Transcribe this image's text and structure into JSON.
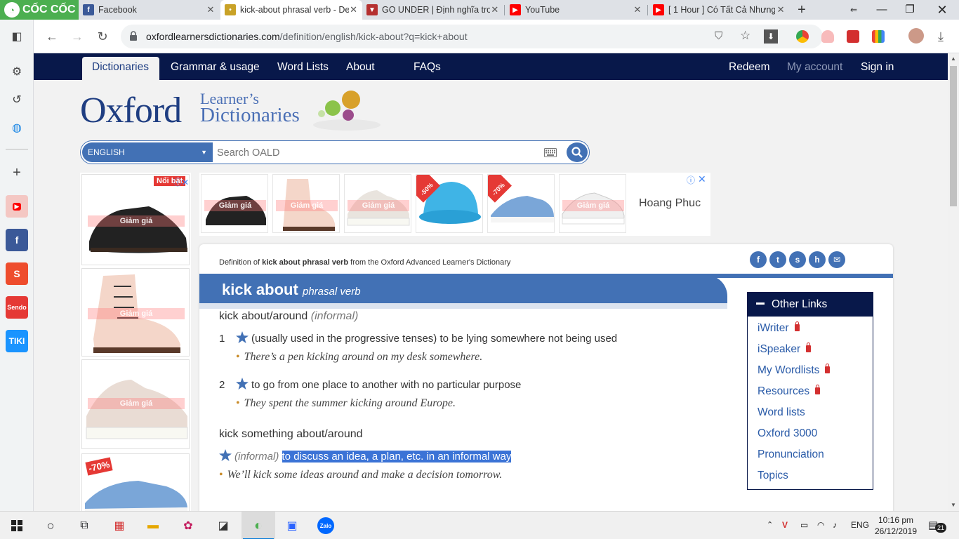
{
  "browser": {
    "brand": "CỐC CỐC",
    "tabs": [
      {
        "title": "Facebook",
        "icon": "facebook-icon",
        "color": "#3b5998"
      },
      {
        "title": "kick-about phrasal verb - Definition",
        "icon": "oxford-icon",
        "color": "#c9a227"
      },
      {
        "title": "GO UNDER | Định nghĩa trong",
        "icon": "cambridge-icon",
        "color": "#b53030"
      },
      {
        "title": "YouTube",
        "icon": "youtube-icon",
        "color": "#ff0000"
      },
      {
        "title": "[ 1 Hour ] Có Tất Cả Nhưng",
        "icon": "youtube-icon",
        "color": "#ff0000"
      }
    ],
    "url_host": "oxfordlearnersdictionaries.com",
    "url_path": "/definition/english/kick-about?q=kick+about"
  },
  "site": {
    "nav_left": [
      "Dictionaries",
      "Grammar & usage",
      "Word Lists",
      "About",
      "FAQs"
    ],
    "nav_right": [
      "Redeem",
      "My account",
      "Sign in"
    ],
    "logo_word": "Oxford",
    "logo_line1": "Learner’s",
    "logo_line2": "Dictionaries",
    "search_lang": "ENGLISH",
    "search_placeholder": "Search OALD"
  },
  "ads": {
    "left_label": "Giảm giá",
    "left_badge_top": "Nổi bật",
    "left_badge_bottom": "-70%",
    "top_label": "Giảm giá",
    "top_badges": [
      "-50%",
      "-70%"
    ],
    "top_brand": "Hoang Phuc"
  },
  "entry": {
    "def_prefix": "Definition of ",
    "def_word": "kick about phrasal verb",
    "def_suffix": " from the Oxford Advanced Learner's Dictionary",
    "headword": "kick about",
    "pos": "phrasal verb",
    "pv1": "kick about/around",
    "pv1_label": "(informal)",
    "senses1": [
      {
        "num": "1",
        "text": "(usually used in the progressive tenses) to be lying somewhere not being used",
        "example": "There’s a pen kicking around on my desk somewhere."
      },
      {
        "num": "2",
        "text": "to go from one place to another with no particular purpose",
        "example": "They spent the summer kicking around Europe."
      }
    ],
    "pv2": "kick something about/around",
    "pv2_label": "(informal)",
    "pv2_def": "to discuss an idea, a plan, etc. in an informal way",
    "pv2_example": "We’ll kick some ideas around and make a decision tomorrow."
  },
  "other_links": {
    "title": "Other Links",
    "items": [
      {
        "label": "iWriter",
        "locked": true
      },
      {
        "label": "iSpeaker",
        "locked": true
      },
      {
        "label": "My Wordlists",
        "locked": true
      },
      {
        "label": "Resources",
        "locked": true
      },
      {
        "label": "Word lists",
        "locked": false
      },
      {
        "label": "Oxford 3000",
        "locked": false
      },
      {
        "label": "Pronunciation",
        "locked": false
      },
      {
        "label": "Topics",
        "locked": false
      }
    ]
  },
  "taskbar": {
    "lang": "ENG",
    "time": "10:16 pm",
    "date": "26/12/2019",
    "notif_count": "21"
  },
  "colors": {
    "oxford_navy": "#08184a",
    "oxford_blue": "#4271b5",
    "link_blue": "#2a5ba8",
    "highlight": "#3b73d6"
  }
}
